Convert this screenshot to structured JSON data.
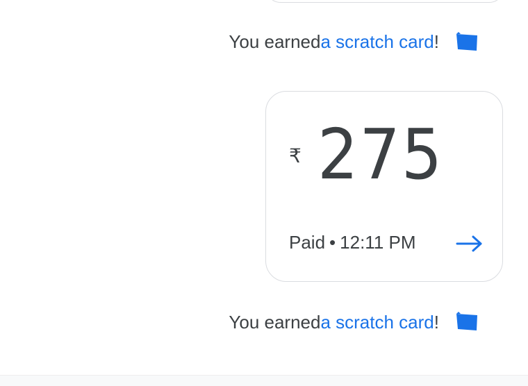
{
  "reward_messages": [
    {
      "prefix": "You earned ",
      "link": "a scratch card",
      "suffix": "!",
      "icon": "scratch-card-icon"
    },
    {
      "prefix": "You earned ",
      "link": "a scratch card",
      "suffix": "!",
      "icon": "scratch-card-icon"
    }
  ],
  "payment": {
    "currency_symbol": "₹",
    "amount": "275",
    "status": "Paid",
    "separator": "•",
    "time": "12:11 PM",
    "arrow_icon": "arrow-right-icon"
  },
  "colors": {
    "link": "#1a73e8",
    "icon": "#1a73e8",
    "text": "#3c4043",
    "border": "#dadce0"
  }
}
